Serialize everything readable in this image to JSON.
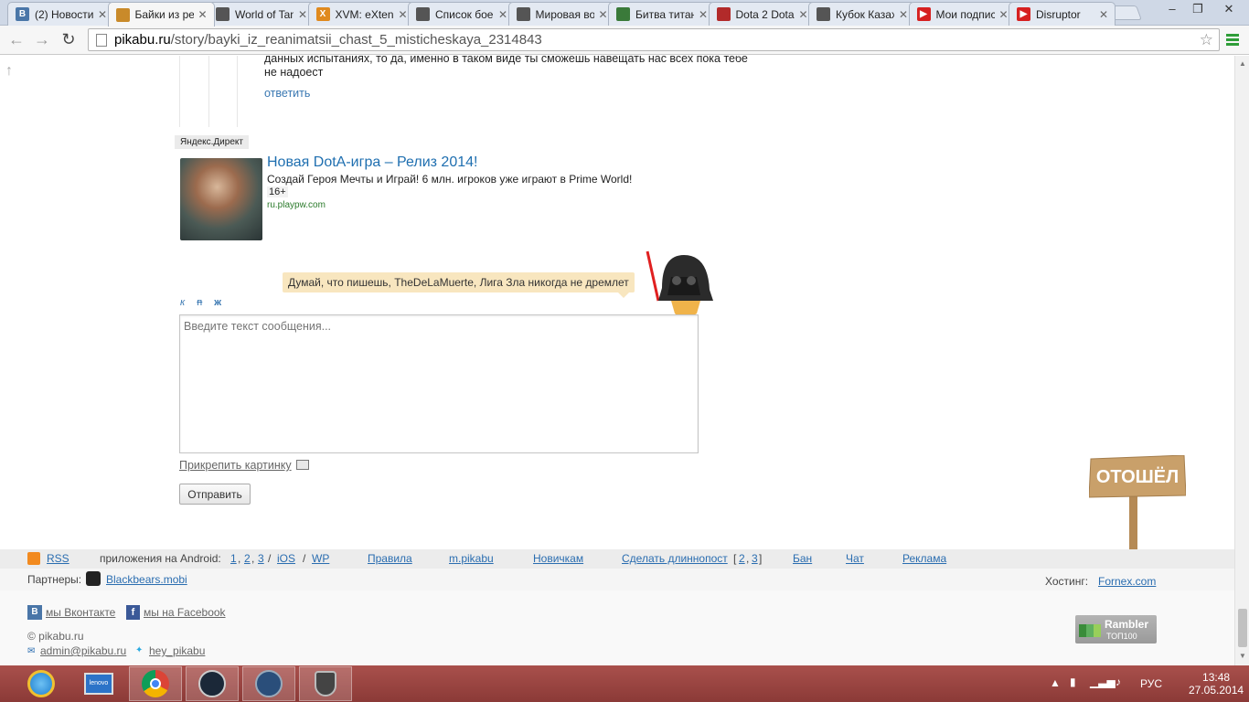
{
  "browser": {
    "tabs": [
      {
        "title": "(2) Новости",
        "favicon": "vk-icon",
        "color": "#4a76a8",
        "glyph": "В",
        "active": false
      },
      {
        "title": "Байки из реанимации",
        "favicon": "pikabu-icon",
        "color": "#c98a2a",
        "glyph": "",
        "active": true
      },
      {
        "title": "World of Tanks",
        "favicon": "wot-icon",
        "color": "#555555",
        "glyph": "",
        "active": false
      },
      {
        "title": "XVM: eXtended",
        "favicon": "xvm-icon",
        "color": "#e08a1e",
        "glyph": "X",
        "active": false
      },
      {
        "title": "Список боев",
        "favicon": "wot-icon",
        "color": "#555555",
        "glyph": "",
        "active": false
      },
      {
        "title": "Мировая война",
        "favicon": "wot-icon",
        "color": "#555555",
        "glyph": "",
        "active": false
      },
      {
        "title": "Битва титанов",
        "favicon": "page-icon",
        "color": "#3a7a3a",
        "glyph": "",
        "active": false
      },
      {
        "title": "Dota 2 Dota",
        "favicon": "dota-icon",
        "color": "#b22a2a",
        "glyph": "",
        "active": false
      },
      {
        "title": "Кубок Казахстана",
        "favicon": "wot-icon",
        "color": "#555555",
        "glyph": "",
        "active": false
      },
      {
        "title": "Мои подписки",
        "favicon": "youtube-icon",
        "color": "#d62020",
        "glyph": "▶",
        "active": false
      },
      {
        "title": "Disruptor",
        "favicon": "youtube-icon",
        "color": "#d62020",
        "glyph": "▶",
        "active": false
      }
    ],
    "tab_close": "✕",
    "url_host": "pikabu.ru",
    "url_path": "/story/bayki_iz_reanimatsii_chast_5_misticheskaya_2314843"
  },
  "comment": {
    "text": "данных испытаниях, то да, именно в таком виде ты сможешь навещать нас всех пока тебе не надоест",
    "reply": "ответить"
  },
  "ad": {
    "label": "Яндекс.Директ",
    "title": "Новая DotA-игра – Релиз 2014!",
    "description": "Создай Героя Мечты и Играй! 6 млн. игроков уже играют в Prime World!",
    "age": "16+",
    "domain": "ru.playpw.com"
  },
  "compose": {
    "bubble": "Думай, что пишешь, TheDeLaMuerte, Лига Зла никогда не дремлет",
    "format_italic": "к",
    "format_strike": "п",
    "format_bold": "ж",
    "placeholder": "Введите текст сообщения...",
    "attach": "Прикрепить картинку",
    "send": "Отправить",
    "away_sign": "ОТОШЁЛ"
  },
  "footer": {
    "rss": "RSS",
    "apps_label": "приложения на Android:",
    "android_1": "1",
    "android_2": "2",
    "android_3": "3",
    "sep": "/",
    "ios": "iOS",
    "wp": "WP",
    "rules": "Правила",
    "mobile": "m.pikabu",
    "newbies": "Новичкам",
    "longpost": "Сделать длиннопост",
    "longpost_2": "2",
    "longpost_3": "3",
    "ban": "Бан",
    "chat": "Чат",
    "ads": "Реклама",
    "partners_label": "Партнеры:",
    "partner": "Blackbears.mobi",
    "hosting_label": "Хостинг:",
    "hosting": "Fornex.com",
    "vk": "мы Вконтакте",
    "facebook": "мы на Facebook",
    "copyright": "© pikabu.ru",
    "email": "admin@pikabu.ru",
    "twitter": "hey_pikabu",
    "rambler_1": "Rambler",
    "rambler_2": "ТОП100"
  },
  "taskbar": {
    "lang": "РУС",
    "time": "13:48",
    "date": "27.05.2014"
  }
}
